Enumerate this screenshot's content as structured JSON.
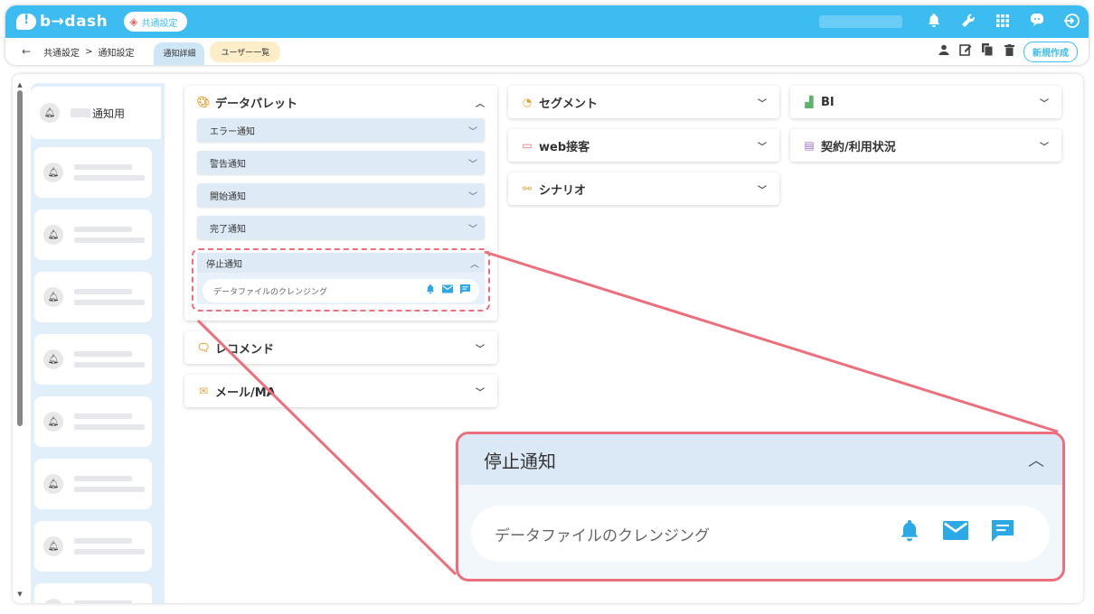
{
  "header": {
    "brand": "b→dash",
    "shared_label": "共通設定",
    "icons": [
      "bell-icon",
      "wrench-icon",
      "grid-icon",
      "chat-icon",
      "logout-icon"
    ]
  },
  "subbar": {
    "crumb_1": "共通設定",
    "crumb_sep": ">",
    "crumb_2": "通知設定",
    "tab_detail": "通知詳細",
    "tab_users": "ユーザー一覧",
    "new_button": "新規作成",
    "icons": [
      "user-icon",
      "edit-icon",
      "copy-icon",
      "trash-icon"
    ]
  },
  "sidebar": {
    "active_label_suffix": "通知用"
  },
  "accordions": {
    "data_palette": {
      "title": "データパレット",
      "subs": [
        "エラー通知",
        "警告通知",
        "開始通知",
        "完了通知"
      ],
      "stop": {
        "title": "停止通知",
        "item": "データファイルのクレンジング"
      }
    },
    "recommend": "レコメンド",
    "mail": "メール/MA",
    "segment": "セグメント",
    "web": "web接客",
    "scenario": "シナリオ",
    "bi": "BI",
    "contract": "契約/利用状況"
  },
  "callout": {
    "title": "停止通知",
    "item": "データファイルのクレンジング"
  },
  "colors": {
    "brand": "#3dbcf2",
    "highlight": "#ec6f7b",
    "icon_blue": "#2ba8e6"
  }
}
